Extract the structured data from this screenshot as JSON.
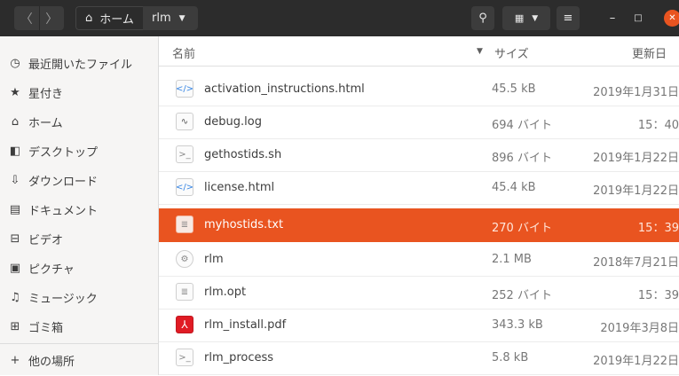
{
  "header": {
    "back_icon": "chevron-left-icon",
    "forward_icon": "chevron-right-icon",
    "breadcrumb": [
      {
        "label": "ホーム",
        "icon": "home-icon"
      },
      {
        "label": "rlm",
        "icon": "chevron-down-icon"
      }
    ],
    "buttons": [
      "search-icon",
      "grid-view-icon",
      "chevron-down-icon",
      "menu-icon",
      "minimize-icon",
      "maximize-icon",
      "close-icon"
    ],
    "close_color": "#e95420"
  },
  "sidebar": {
    "items": [
      {
        "label": "最近開いたファイル",
        "icon": "clock-icon"
      },
      {
        "label": "星付き",
        "icon": "star-icon"
      },
      {
        "label": "ホーム",
        "icon": "home-icon"
      },
      {
        "label": "デスクトップ",
        "icon": "desktop-icon"
      },
      {
        "label": "ダウンロード",
        "icon": "download-icon"
      },
      {
        "label": "ドキュメント",
        "icon": "document-icon"
      },
      {
        "label": "ビデオ",
        "icon": "video-icon"
      },
      {
        "label": "ピクチャ",
        "icon": "picture-icon"
      },
      {
        "label": "ミュージック",
        "icon": "music-icon"
      },
      {
        "label": "ゴミ箱",
        "icon": "trash-icon"
      },
      {
        "label": "他の場所",
        "icon": "plus-icon"
      }
    ]
  },
  "columns": {
    "name": "名前",
    "size": "サイズ",
    "modified": "更新日"
  },
  "files": [
    {
      "name": "activation_instructions.html",
      "size": "45.5 kB",
      "date": "2019年1月31日",
      "icon": "html-file-icon",
      "selected": false
    },
    {
      "name": "debug.log",
      "size": "694 バイト",
      "date": "15：40",
      "icon": "log-file-icon",
      "selected": false
    },
    {
      "name": "gethostids.sh",
      "size": "896 バイト",
      "date": "2019年1月22日",
      "icon": "script-file-icon",
      "selected": false
    },
    {
      "name": "license.html",
      "size": "45.4 kB",
      "date": "2019年1月22日",
      "icon": "html-file-icon",
      "selected": false
    },
    {
      "name": "myhostids.txt",
      "size": "270 バイト",
      "date": "15：39",
      "icon": "text-file-icon",
      "selected": true
    },
    {
      "name": "rlm",
      "size": "2.1 MB",
      "date": "2018年7月21日",
      "icon": "executable-file-icon",
      "selected": false
    },
    {
      "name": "rlm.opt",
      "size": "252 バイト",
      "date": "15：39",
      "icon": "text-file-icon",
      "selected": false
    },
    {
      "name": "rlm_install.pdf",
      "size": "343.3 kB",
      "date": "2019年3月8日",
      "icon": "pdf-file-icon",
      "selected": false
    },
    {
      "name": "rlm_process",
      "size": "5.8 kB",
      "date": "2019年1月22日",
      "icon": "script-file-icon",
      "selected": false
    }
  ],
  "colors": {
    "accent": "#e95420",
    "header_bg": "#2c2c2c",
    "sidebar_bg": "#f6f5f4"
  }
}
